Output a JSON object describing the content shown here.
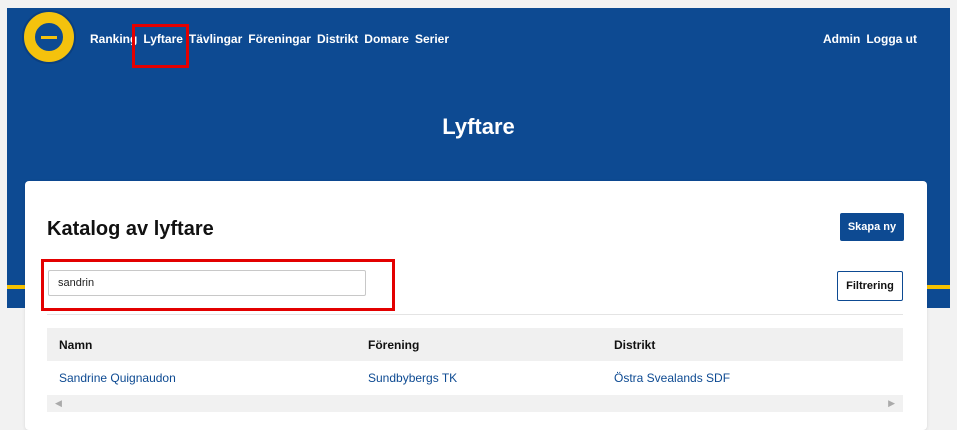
{
  "nav": {
    "items": [
      "Ranking",
      "Lyftare",
      "Tävlingar",
      "Föreningar",
      "Distrikt",
      "Domare",
      "Serier"
    ],
    "right": [
      "Admin",
      "Logga ut"
    ]
  },
  "page": {
    "title": "Lyftare"
  },
  "catalog": {
    "title": "Katalog av lyftare",
    "create_label": "Skapa ny",
    "search_value": "sandrin",
    "filter_label": "Filtrering"
  },
  "table": {
    "headers": [
      "Namn",
      "Förening",
      "Distrikt"
    ],
    "rows": [
      [
        "Sandrine Quignaudon",
        "Sundbybergs TK",
        "Östra Svealands SDF"
      ]
    ]
  },
  "colors": {
    "brand": "#0d4a92",
    "accent": "#f5c100",
    "highlight": "#e30000"
  }
}
